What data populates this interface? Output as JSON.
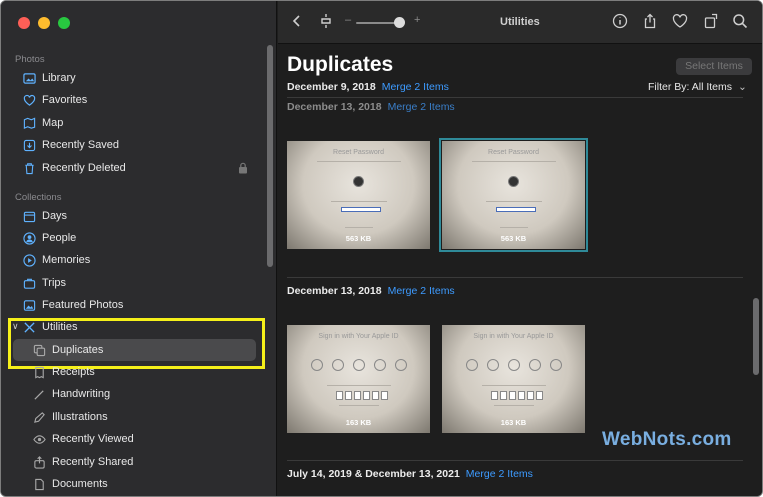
{
  "sidebar": {
    "sections": [
      {
        "title": "Photos"
      },
      {
        "title": "Collections"
      }
    ],
    "items": [
      {
        "label": "Library",
        "icon": "library-icon"
      },
      {
        "label": "Favorites",
        "icon": "heart-icon"
      },
      {
        "label": "Map",
        "icon": "map-icon"
      },
      {
        "label": "Recently Saved",
        "icon": "download-icon"
      },
      {
        "label": "Recently Deleted",
        "icon": "trash-icon"
      },
      {
        "label": "Days",
        "icon": "calendar-icon"
      },
      {
        "label": "People",
        "icon": "person-icon"
      },
      {
        "label": "Memories",
        "icon": "memories-icon"
      },
      {
        "label": "Trips",
        "icon": "suitcase-icon"
      },
      {
        "label": "Featured Photos",
        "icon": "photo-icon"
      },
      {
        "label": "Utilities",
        "icon": "utilities-icon"
      },
      {
        "label": "Duplicates",
        "icon": "duplicate-icon"
      },
      {
        "label": "Receipts",
        "icon": "receipt-icon"
      },
      {
        "label": "Handwriting",
        "icon": "pen-icon"
      },
      {
        "label": "Illustrations",
        "icon": "brush-icon"
      },
      {
        "label": "Recently Viewed",
        "icon": "eye-icon"
      },
      {
        "label": "Recently Shared",
        "icon": "share-icon"
      },
      {
        "label": "Documents",
        "icon": "document-icon"
      }
    ],
    "selected": "Duplicates"
  },
  "toolbar": {
    "title": "Utilities",
    "zoom_minus": "–",
    "zoom_plus": "+",
    "zoom_level": 0.9
  },
  "main": {
    "title": "Duplicates",
    "select_button": "Select Items",
    "filter_label": "Filter By: All Items",
    "groups": [
      {
        "date": "December 9, 2018",
        "merge": "Merge 2 Items"
      },
      {
        "date": "December 13, 2018",
        "merge": "Merge 2 Items"
      },
      {
        "date": "December 13, 2018",
        "merge": "Merge 2 Items"
      },
      {
        "date": "July 14, 2019 & December 13, 2021",
        "merge": "Merge 2 Items"
      }
    ],
    "thumbs": [
      {
        "title": "Reset Password",
        "size": "563 KB"
      },
      {
        "title": "Reset Password",
        "size": "563 KB"
      },
      {
        "title": "Sign in with Your Apple ID",
        "size": "163 KB"
      },
      {
        "title": "Sign in with Your Apple ID",
        "size": "163 KB"
      }
    ]
  },
  "watermark": "WebNots.com",
  "colors": {
    "accent": "#3d9bff",
    "highlight_box": "#f5f01a",
    "selection_outline": "#2f8a99"
  }
}
